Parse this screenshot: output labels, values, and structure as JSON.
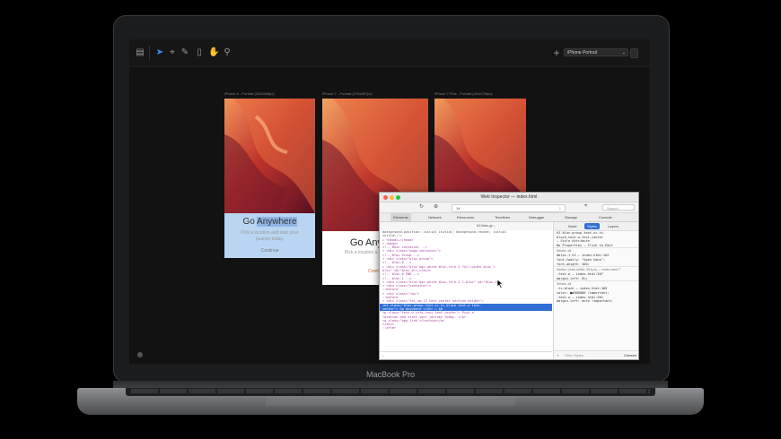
{
  "toolbar": {
    "device_select": "iPhone Portrait"
  },
  "devices": [
    {
      "label": "iPhone 6 - Portrait (320x568px)",
      "heading_plain": "Go ",
      "heading_highlight": "Anywhere",
      "subtext": "Pick a location and start your journey today.",
      "link": "Continue"
    },
    {
      "label": "iPhone 7 - Portrait (375x667px)",
      "heading_plain": "Go Anywhe",
      "heading_highlight": "",
      "subtext": "Pick a location a... journey to...",
      "link": "Conti..."
    },
    {
      "label": "iPhone 7 Plus - Portrait (414x736px)",
      "heading_plain": "",
      "heading_highlight": "",
      "subtext": "",
      "link": ""
    }
  ],
  "inspector": {
    "title": "Web Inspector — index.html",
    "toolbar": {
      "tab_count": "14",
      "warnings": "1",
      "search_placeholder": "Search"
    },
    "tabs": [
      "Elements",
      "Network",
      "Resources",
      "Timelines",
      "Debugger",
      "Storage",
      "Console"
    ],
    "dom_path": "h2.bloc-gr...",
    "dom_lines": [
      "background-position: initial initial; background-repeat: initial",
      "initial;\">",
      "▸ <head>…</head>",
      "▾ <body>",
      "  <!-- Main container -->",
      "  ▾ <div class=\"page-container\">",
      "    <!-- Bloc Group -->",
      "    ▾ <div class=\"bloc-group\">",
      "      <!-- bloc-0 -->",
      "      ▸ <div class=\"bloc bgc-white bloc-tile-2 full-width-bloc l-",
      "      bloc\" id=\"bloc-0\">…</div>",
      "      <!-- bloc-0 END -->",
      "      <!-- bloc-1 -->",
      "      ▾ <div class=\"bloc bgc-white bloc-tile-2 l-bloc\" id=\"bloc-1\">",
      "        ▾ <div class=\"container\">",
      "          ::before",
      "          ▾ <div class=\"row\">",
      "            ::before",
      "            ▾ <div class=\"col-sm-12 text-center section-height\">",
      "              <h2 class=\"bloc-group-text-xc tc-black text-w text-",
      "              center\"> Go Anywhere </h2> = $0",
      "              <p class=\"text-w info-text text-center\"> Pick a",
      "              location and start your journey today. </p>",
      "              <a class=\"app-link\">Continue</a>",
      "            </div>",
      "            ::after"
    ],
    "selected_lines": [
      19,
      20
    ],
    "sidebar_tabs": [
      "Node",
      "Styles",
      "Layers"
    ],
    "styles": [
      {
        "kind": "line",
        "text": "h2.bloc-group-text-xc.tc-"
      },
      {
        "kind": "line",
        "text": "black.text-w.text-center"
      },
      {
        "kind": "line",
        "text": "— Style Attribute"
      },
      {
        "kind": "line",
        "text": "No Properties — Click to Edit"
      },
      {
        "kind": "head",
        "text": "Media: all"
      },
      {
        "kind": "line",
        "text": "#bloc-1 h2 — index.html:162"
      },
      {
        "kind": "line",
        "text": "font-family: \"Open Sans\";"
      },
      {
        "kind": "line",
        "text": "font-weight: 400;"
      },
      {
        "kind": "head",
        "text": "Media: (max-width: 991px) — index.html:7"
      },
      {
        "kind": "line",
        "text": ".text-w — index.html:367"
      },
      {
        "kind": "line",
        "text": "margin-left: 0%;"
      },
      {
        "kind": "head",
        "text": "Media: all"
      },
      {
        "kind": "line",
        "text": ".tc-black — index.html:409"
      },
      {
        "kind": "line",
        "text": "color: ■#000000 !important;"
      },
      {
        "kind": "line",
        "text": ".text-w — index.html:361"
      },
      {
        "kind": "line",
        "text": "margin-left: auto !important;"
      }
    ],
    "filter_placeholder": "Filter Styles",
    "classes_button": "Classes",
    "console_prompt": "›"
  },
  "laptop": {
    "brand": "MacBook Pro"
  }
}
